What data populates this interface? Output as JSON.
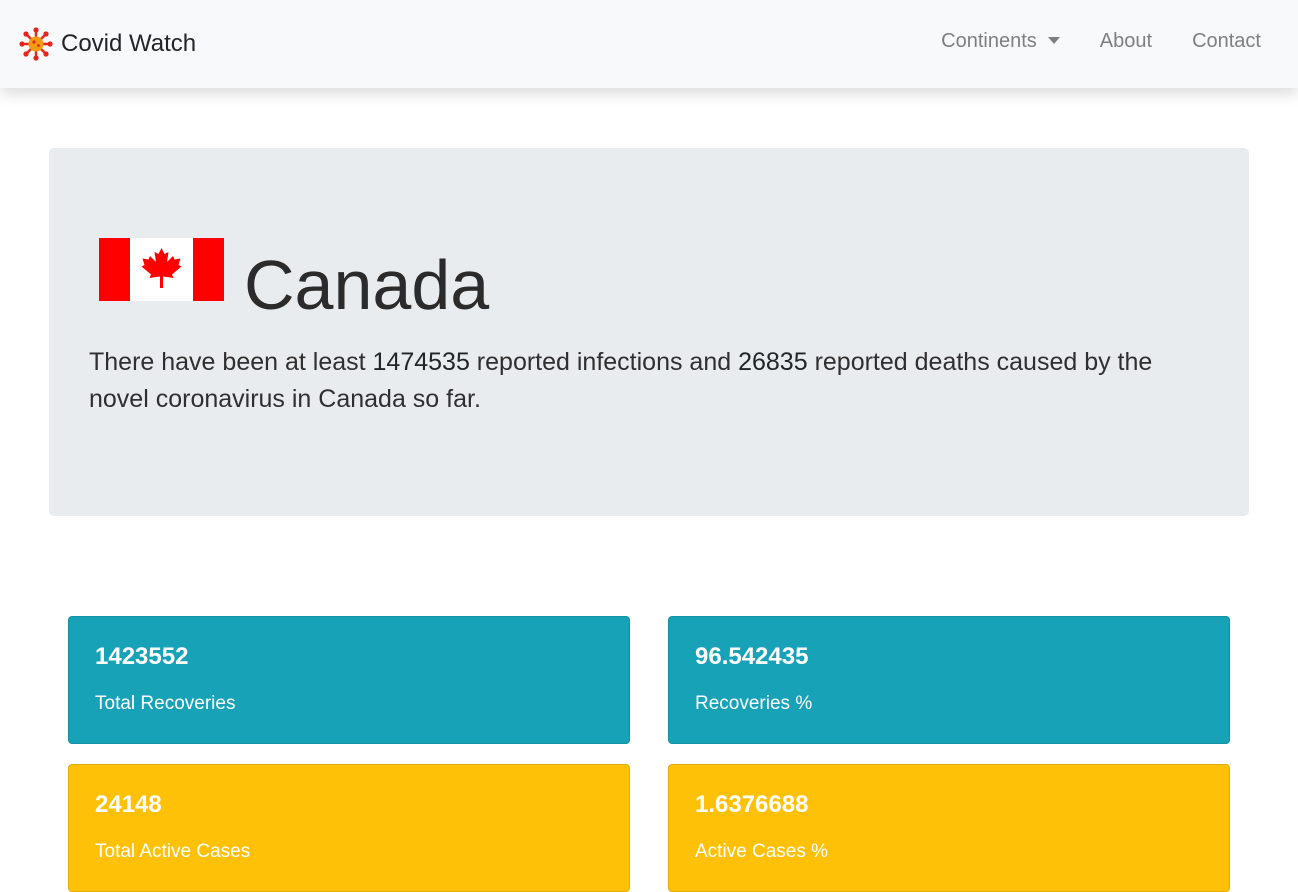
{
  "navbar": {
    "brand": "Covid Watch",
    "links": {
      "continents": "Continents",
      "about": "About",
      "contact": "Contact"
    }
  },
  "country": {
    "name": "Canada",
    "summary": {
      "part1": "There have been at least ",
      "infections": "1474535",
      "part2": " reported infections and ",
      "deaths": "26835",
      "part3": " reported deaths caused by the novel coronavirus in Canada so far."
    }
  },
  "stats": [
    {
      "value": "1423552",
      "label": "Total Recoveries"
    },
    {
      "value": "96.542435",
      "label": "Recoveries %"
    },
    {
      "value": "24148",
      "label": "Total Active Cases"
    },
    {
      "value": "1.6376688",
      "label": "Active Cases %"
    }
  ],
  "colors": {
    "info": "#17a2b8",
    "warning": "#ffc107",
    "flag_red": "#ff0000",
    "jumbotron": "#e9ecef"
  },
  "icons": {
    "brand": "virus-icon",
    "continents_dropdown": "caret-down-icon",
    "flag": "canada-flag"
  }
}
